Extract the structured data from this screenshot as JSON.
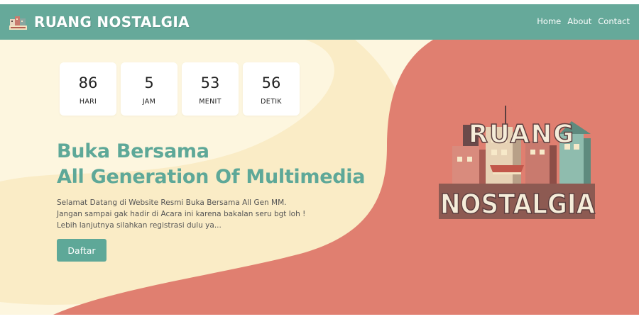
{
  "navbar": {
    "brand_text": "RUANG NOSTALGIA",
    "links": [
      "Home",
      "About",
      "Contact"
    ]
  },
  "countdown": {
    "days": {
      "value": "86",
      "label": "HARI"
    },
    "hours": {
      "value": "5",
      "label": "JAM"
    },
    "minutes": {
      "value": "53",
      "label": "MENIT"
    },
    "seconds": {
      "value": "56",
      "label": "DETIK"
    }
  },
  "hero": {
    "title_line1": "Buka Bersama",
    "title_line2": "All Generation Of Multimedia",
    "desc_line1": "Selamat Datang di Website Resmi Buka Bersama All Gen MM.",
    "desc_line2": "Jangan sampai gak hadir di Acara ini karena bakalan seru bgt loh !",
    "desc_line3": "Lebih lanjutnya silahkan registrasi dulu ya...",
    "button_label": "Daftar"
  },
  "illustration": {
    "word_top": "RUANG",
    "word_bottom": "NOSTALGIA"
  },
  "colors": {
    "navbar": "#66a99a",
    "accent": "#5ea898",
    "background_cream": "#fdf6df",
    "background_wave": "#faecc6",
    "background_coral": "#e07f70"
  },
  "icons": {
    "brand_logo": "ruang-nostalgia-logo-icon"
  }
}
